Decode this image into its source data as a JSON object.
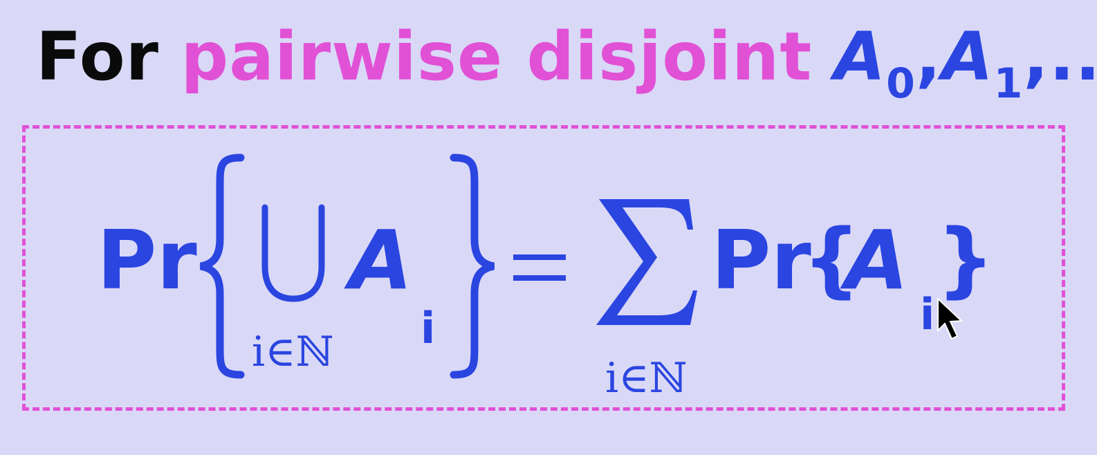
{
  "heading": {
    "word_for": "For",
    "word_qualifier": "pairwise disjoint",
    "set_a0": "A",
    "sub_0": "0",
    "comma_1": ",",
    "set_a1": "A",
    "sub_1": "1",
    "trailing": ",..."
  },
  "formula": {
    "lhs_pr": "Pr",
    "union_set": "A",
    "union_index": "i",
    "union_under": "i∈ℕ",
    "equals": "=",
    "sum_under": "i∈ℕ",
    "rhs_pr": "Pr",
    "rhs_open": "{",
    "rhs_set": "A",
    "rhs_index": "i",
    "rhs_close": "}"
  },
  "colors": {
    "background": "#d9d8f7",
    "heading_text": "#0a0a0a",
    "accent_pink": "#e151d6",
    "math_blue": "#2a45e0"
  },
  "icons": {
    "cursor": "mouse-pointer-icon"
  }
}
